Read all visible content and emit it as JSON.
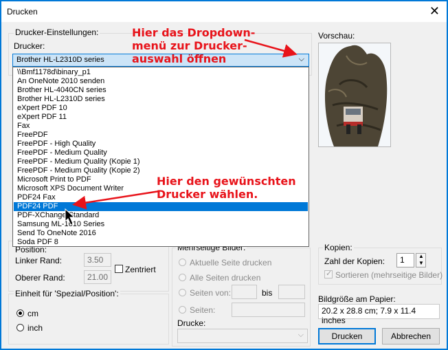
{
  "window": {
    "title": "Drucken"
  },
  "printer_settings": {
    "group_title": "Drucker-Einstellungen:",
    "printer_label": "Drucker:",
    "selected_printer": "Brother HL-L2310D series",
    "options": [
      "\\\\Bmf1178d\\binary_p1",
      "An OneNote 2010 senden",
      "Brother HL-4040CN series",
      "Brother HL-L2310D series",
      "eXpert PDF 10",
      "eXpert PDF 11",
      "Fax",
      "FreePDF",
      "FreePDF - High Quality",
      "FreePDF - Medium Quality",
      "FreePDF - Medium Quality (Kopie 1)",
      "FreePDF - Medium Quality (Kopie 2)",
      "Microsoft Print to PDF",
      "Microsoft XPS Document Writer",
      "PDF24 Fax",
      "PDF24 PDF",
      "PDF-XChange Standard",
      "Samsung ML-1610 Series",
      "Send To OneNote 2016",
      "Soda PDF 8"
    ],
    "highlighted_index": 15
  },
  "annotations": {
    "dropdown_hint": "Hier das Dropdown-\nmenü zur Drucker-\nauswahl öffnen",
    "select_hint": "Hier den gewünschten\nDrucker wählen."
  },
  "position": {
    "group_title": "Position:",
    "left_margin_label": "Linker Rand:",
    "left_margin_value": "3.50",
    "top_margin_label": "Oberer Rand:",
    "top_margin_value": "21.00",
    "center_label": "Zentriert"
  },
  "units": {
    "group_title": "Einheit für 'Spezial/Position':",
    "cm_label": "cm",
    "inch_label": "inch",
    "selected": "cm"
  },
  "multipage": {
    "group_title": "Mehrseitige Bilder:",
    "current_page": "Aktuelle Seite drucken",
    "all_pages": "Alle Seiten drucken",
    "pages_from": "Seiten von:",
    "to_label": "bis",
    "pages_label": "Seiten:",
    "prints_label": "Drucke:"
  },
  "preview": {
    "label": "Vorschau:"
  },
  "copies": {
    "group_title": "Kopien:",
    "count_label": "Zahl der Kopien:",
    "count_value": "1",
    "sort_label": "Sortieren (mehrseitige Bilder)"
  },
  "paper": {
    "label": "Bildgröße am Papier:",
    "value": "20.2 x 28.8 cm; 7.9 x 11.4 inches"
  },
  "buttons": {
    "print": "Drucken",
    "cancel": "Abbrechen"
  },
  "colors": {
    "accent": "#0078d7",
    "annotation": "#e8131a"
  }
}
